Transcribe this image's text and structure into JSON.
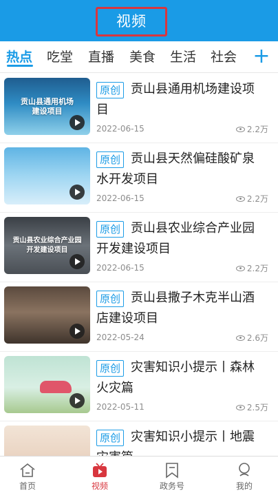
{
  "header": {
    "title": "视频"
  },
  "tabs": [
    {
      "label": "热点",
      "active": true
    },
    {
      "label": "吃堂",
      "active": false
    },
    {
      "label": "直播",
      "active": false
    },
    {
      "label": "美食",
      "active": false
    },
    {
      "label": "生活",
      "active": false
    },
    {
      "label": "社会",
      "active": false
    }
  ],
  "add_tab_label": "+",
  "videos": [
    {
      "thumb_text": "贡山县通用机场\n建设项目",
      "badge": "原创",
      "title": "贡山县通用机场建设项目",
      "date": "2022-06-15",
      "views": "2.2万"
    },
    {
      "thumb_text": "",
      "badge": "原创",
      "title": "贡山县天然偏硅酸矿泉水开发项目",
      "date": "2022-06-15",
      "views": "2.2万"
    },
    {
      "thumb_text": "贡山县农业综合产业园\n开发建设项目",
      "badge": "原创",
      "title": "贡山县农业综合产业园开发建设项目",
      "date": "2022-06-15",
      "views": "2.2万"
    },
    {
      "thumb_text": "",
      "badge": "原创",
      "title": "贡山县撒子木克半山酒店建设项目",
      "date": "2022-05-24",
      "views": "2.6万"
    },
    {
      "thumb_text": "",
      "badge": "原创",
      "title": "灾害知识小提示丨森林火灾篇",
      "date": "2022-05-11",
      "views": "2.5万"
    },
    {
      "thumb_text": "",
      "badge": "原创",
      "title": "灾害知识小提示丨地震灾害篇",
      "date": "",
      "views": ""
    }
  ],
  "bottom_nav": [
    {
      "label": "首页",
      "icon": "home-icon",
      "active": false
    },
    {
      "label": "视频",
      "icon": "video-icon",
      "active": true
    },
    {
      "label": "政务号",
      "icon": "bookmark-icon",
      "active": false
    },
    {
      "label": "我的",
      "icon": "profile-icon",
      "active": false
    }
  ],
  "colors": {
    "primary": "#1a9be6",
    "highlight_red": "#d8363e"
  }
}
